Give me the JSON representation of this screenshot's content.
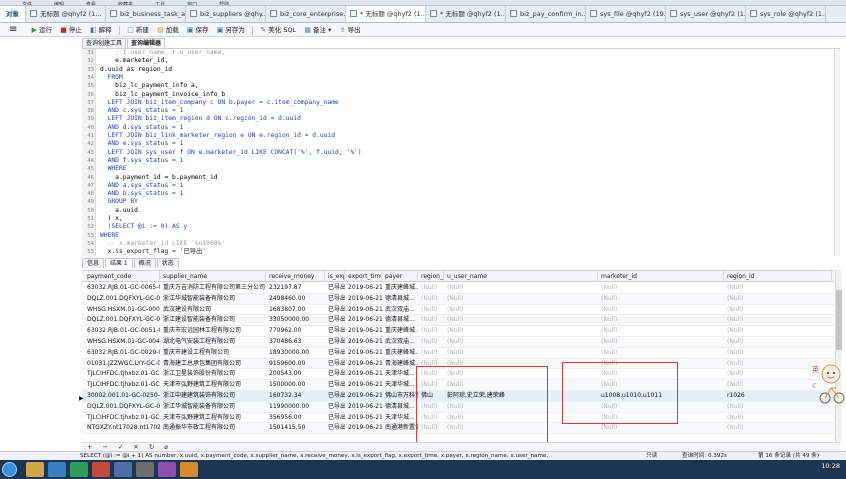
{
  "top_menu": [
    "文件",
    "编辑",
    "查看",
    "收藏夹",
    "工具",
    "窗口",
    "帮助"
  ],
  "tabs": [
    {
      "label": "对象",
      "active": false
    },
    {
      "label": "无标题 @qhyf2 (1...",
      "active": false
    },
    {
      "label": "biz_business_task_a...",
      "active": false
    },
    {
      "label": "biz_suppliers @qhy...",
      "active": false
    },
    {
      "label": "biz_core_enterprise...",
      "active": false
    },
    {
      "label": "* 无标题 @qhyf2 (1...",
      "active": true
    },
    {
      "label": "* 无标题 @qhyf2 (1...",
      "active": false
    },
    {
      "label": "biz_pay_confirm_in...",
      "active": false
    },
    {
      "label": "sys_file @qhyf2 (19...",
      "active": false
    },
    {
      "label": "sys_user @qhyf2 (1...",
      "active": false
    },
    {
      "label": "sys_role @qhyf2 (1...",
      "active": false
    }
  ],
  "toolbar": {
    "menu": "≡",
    "run": "运行",
    "stop": "停止",
    "explain": "解释",
    "new": "新建",
    "load": "加载",
    "save": "保存",
    "save_as": "另存为",
    "beautify": "美化 SQL",
    "comment": "备注",
    "export": "导出"
  },
  "editor_tabs": [
    {
      "label": "查询创建工具",
      "active": false
    },
    {
      "label": "查询编辑器",
      "active": true
    }
  ],
  "editor": {
    "lines": [
      {
        "n": "31",
        "code": "    , t.user_name, r.u_user_name,"
      },
      {
        "n": "32",
        "code": "    e.marketer_id,"
      },
      {
        "n": "33",
        "code": "d.uuid as region_id"
      },
      {
        "n": "34",
        "code": "  FROM"
      },
      {
        "n": "35",
        "code": "    biz_lc_payment_info a,"
      },
      {
        "n": "36",
        "code": "    biz_lc_payment_invoice_info b"
      },
      {
        "n": "37",
        "code": "  LEFT JOIN biz_item_company c ON b.payer = c.item_company_name"
      },
      {
        "n": "38",
        "code": "  AND c.sys_status = 1"
      },
      {
        "n": "39",
        "code": "  LEFT JOIN biz_item_region d ON c.region_id = d.uuid"
      },
      {
        "n": "40",
        "code": "  AND d.sys_status = 1"
      },
      {
        "n": "41",
        "code": "  LEFT JOIN biz_link_marketer_region e ON e.region_id = d.uuid"
      },
      {
        "n": "42",
        "code": "  AND e.sys_status = 1"
      },
      {
        "n": "43",
        "code": "  LEFT JOIN sys_user f ON e.marketer_id LIKE CONCAT('%', f.uuid, '%')"
      },
      {
        "n": "44",
        "code": "  AND f.sys_status = 1"
      },
      {
        "n": "45",
        "code": "  WHERE"
      },
      {
        "n": "46",
        "code": "    a.payment_id = b.payment_id"
      },
      {
        "n": "47",
        "code": "  AND a.sys_status = 1"
      },
      {
        "n": "48",
        "code": "  AND b.sys_status = 1"
      },
      {
        "n": "49",
        "code": "  GROUP BY"
      },
      {
        "n": "50",
        "code": "    a.uuid"
      },
      {
        "n": "51",
        "code": "  ) x,"
      },
      {
        "n": "52",
        "code": "  (SELECT @i := 0) AS y"
      },
      {
        "n": "53",
        "code": "WHERE"
      },
      {
        "n": "54",
        "code": "  -- x.marketer_id LIKE '%u1008%'"
      },
      {
        "n": "55",
        "code": "  x.is_export_flag = '已导出'"
      }
    ]
  },
  "result_tabs": [
    {
      "label": "信息",
      "active": false
    },
    {
      "label": "结果 1",
      "active": true
    },
    {
      "label": "概况",
      "active": false
    },
    {
      "label": "状态",
      "active": false
    }
  ],
  "grid": {
    "columns": [
      "payment_code",
      "supplier_name",
      "receive_money",
      "is_expc",
      "export_time",
      "payer",
      "region_",
      "u_user_name",
      "marketer_id",
      "region_id"
    ],
    "rows": [
      [
        "63032.RJB.01-GC-0065-0C",
        "重庆万吉消防工程有限公司第三分公司",
        "232197.87",
        "已导出",
        "2019-06-21",
        "重庆建峰城...",
        "(Null)",
        "(Null)",
        "(Null)",
        "(Null)"
      ],
      [
        "DQLZ.001.DQFXYL-GC-00",
        "浙江华城智能装备有限公司",
        "2498460.00",
        "已导出",
        "2019-06-21",
        "德清县城...",
        "(Null)",
        "(Null)",
        "(Null)",
        "(Null)"
      ],
      [
        "WHSG.HSXM.01-GC-0003",
        "武汉建设有限公司",
        "1683807.00",
        "已导出",
        "2019-06-21",
        "武汉双庙...",
        "(Null)",
        "(Null)",
        "(Null)",
        "(Null)"
      ],
      [
        "DQLZ.001.DQFXYL-GC-00",
        "浙江建设智能装备有限公司",
        "33050000.00",
        "已导出",
        "2019-06-21",
        "德清县城...",
        "(Null)",
        "(Null)",
        "(Null)",
        "(Null)"
      ],
      [
        "63032.RJB.01-GC-0051-0C",
        "重庆市宏远园林工程有限公司",
        "770962.00",
        "已导出",
        "2019-06-21",
        "重庆建峰城...",
        "(Null)",
        "(Null)",
        "(Null)",
        "(Null)"
      ],
      [
        "WHSG.HSXM.01-GC-0046",
        "湖北电气安装工程有限公司",
        "370486.63",
        "已导出",
        "2019-06-21",
        "武汉双庙...",
        "(Null)",
        "(Null)",
        "(Null)",
        "(Null)"
      ],
      [
        "63032.RJB.01-GC-0029-0C",
        "重庆市建设工程有限公司",
        "18930000.00",
        "已导出",
        "2019-06-21",
        "重庆建峰城...",
        "(Null)",
        "(Null)",
        "(Null)",
        "(Null)"
      ],
      [
        "01031.JZZWGC.LYY-GC-0C",
        "青海建工总承包集团有限公司",
        "9159600.00",
        "已导出",
        "2019-06-21",
        "青海建峰城...",
        "(Null)",
        "(Null)",
        "(Null)",
        "(Null)"
      ],
      [
        "TJLCIHFDC.tjhxbz.01-GC-",
        "浙江卫星装饰股份有限公司",
        "200543.00",
        "已导出",
        "2019-06-21",
        "天津华城...",
        "(Null)",
        "(Null)",
        "(Null)",
        "(Null)"
      ],
      [
        "TJLCIHFDC.tjhxbz.01-GC-",
        "天津市弘野建筑工程有限公司",
        "1500000.00",
        "已导出",
        "2019-06-21",
        "天津华城...",
        "(Null)",
        "(Null)",
        "(Null)",
        "(Null)"
      ],
      [
        "30002.001.01-GC-0250-0C",
        "浙江中建建筑装饰有限公司",
        "160732.34",
        "已导出",
        "2019-06-21",
        "佛山市万科置...",
        "佛山",
        "彭阿琼,史立荣,唐荣峰",
        "u1008,u1010,u1011",
        "r1026"
      ],
      [
        "DQLZ.001.DQFXYL-GC-00",
        "浙江华城智能装备有限公司",
        "11990000.00",
        "已导出",
        "2019-06-21",
        "德清县城...",
        "(Null)",
        "(Null)",
        "(Null)",
        "(Null)"
      ],
      [
        "TJLCIHFDC.tjhxbz.01-GC-",
        "天津市弘野建筑工程有限公司",
        "356956.00",
        "已导出",
        "2019-06-21",
        "天津华城...",
        "(Null)",
        "(Null)",
        "(Null)",
        "(Null)"
      ],
      [
        "NTGXZY.nt17028.nt17028",
        "南通振华市政工程有限公司",
        "1501415.50",
        "已导出",
        "2019-06-21",
        "南通港新置业...",
        "(Null)",
        "(Null)",
        "(Null)",
        "(Null)"
      ]
    ],
    "selected_row": 10
  },
  "grid_footer": [
    "+",
    "−",
    "✓",
    "✕",
    "↻",
    "⌀"
  ],
  "status": {
    "sql": "SELECT   (@i := @i + 1) AS number,    x.uuid,    x.payment_code,   x.supplier_name,   x.receive_money,   x.is_export_flag,   x.export_time,   x.payer,   x.region_name,   x.user_name,",
    "mode": "只读",
    "query_time": "查询时间: 0.392s",
    "records": "第 16 条记录 (共 49 条)"
  },
  "taskbar": {
    "time": "10:28"
  }
}
